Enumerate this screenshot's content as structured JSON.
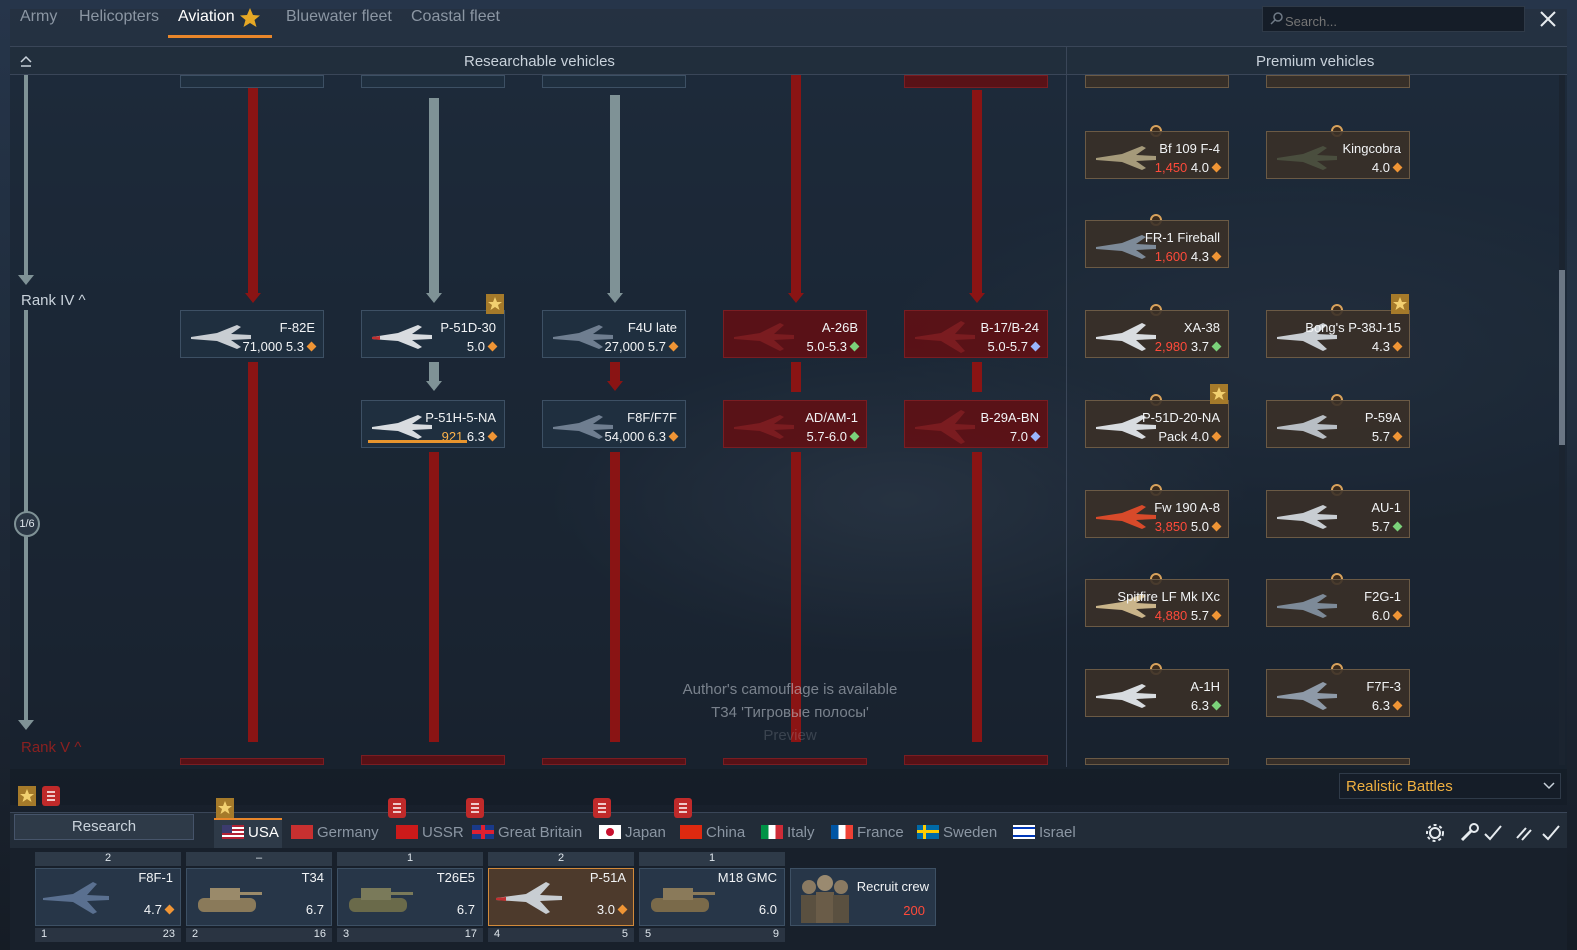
{
  "tabs": [
    {
      "label": "Army",
      "active": false
    },
    {
      "label": "Helicopters",
      "active": false
    },
    {
      "label": "Aviation",
      "active": true
    },
    {
      "label": "Bluewater fleet",
      "active": false
    },
    {
      "label": "Coastal fleet",
      "active": false
    }
  ],
  "search": {
    "placeholder": "Search..."
  },
  "header": {
    "researchable": "Researchable vehicles",
    "premium": "Premium vehicles"
  },
  "rank": {
    "iv": "Rank IV",
    "v": "Rank V"
  },
  "page_indicator": "1/6",
  "research_cards": [
    {
      "name": "F-82E",
      "cost": "71,000",
      "br": "5.3"
    },
    {
      "name": "P-51D-30",
      "cost": "",
      "br": "5.0"
    },
    {
      "name": "F4U late",
      "cost": "27,000",
      "br": "5.7"
    },
    {
      "name": "A-26B",
      "cost": "",
      "br": "5.0-5.3"
    },
    {
      "name": "B-17/B-24",
      "cost": "",
      "br": "5.0-5.7"
    },
    {
      "name": "P-51H-5-NA",
      "cost": "921",
      "br": "6.3",
      "progress": 0.75
    },
    {
      "name": "F8F/F7F",
      "cost": "54,000",
      "br": "6.3"
    },
    {
      "name": "AD/AM-1",
      "cost": "",
      "br": "5.7-6.0"
    },
    {
      "name": "B-29A-BN",
      "cost": "",
      "br": "7.0"
    }
  ],
  "premium_cards": [
    {
      "name": "Bf 109 F-4",
      "cost": "1,450",
      "br": "4.0"
    },
    {
      "name": "Kingcobra",
      "cost": "",
      "br": "4.0"
    },
    {
      "name": "FR-1 Fireball",
      "cost": "1,600",
      "br": "4.3"
    },
    {
      "name": "XA-38",
      "cost": "2,980",
      "br": "3.7"
    },
    {
      "name": "Bong's P-38J-15",
      "cost": "",
      "br": "4.3"
    },
    {
      "name": "P-51D-20-NA",
      "cost": "Pack",
      "br": "4.0"
    },
    {
      "name": "P-59A",
      "cost": "",
      "br": "5.7"
    },
    {
      "name": "Fw 190 A-8",
      "cost": "3,850",
      "br": "5.0"
    },
    {
      "name": "AU-1",
      "cost": "",
      "br": "5.7"
    },
    {
      "name": "Spitfire LF Mk IXc",
      "cost": "4,880",
      "br": "5.7"
    },
    {
      "name": "F2G-1",
      "cost": "",
      "br": "6.0"
    },
    {
      "name": "A-1H",
      "cost": "",
      "br": "6.3"
    },
    {
      "name": "F7F-3",
      "cost": "",
      "br": "6.3"
    }
  ],
  "notice": {
    "line1": "Author's camouflage is available",
    "line2": "T34 'Тигровые полосы'",
    "line3": "Preview"
  },
  "game_mode": "Realistic Battles",
  "research_button": "Research",
  "nations": [
    "USA",
    "Germany",
    "USSR",
    "Great Britain",
    "Japan",
    "China",
    "Italy",
    "France",
    "Sweden",
    "Israel"
  ],
  "crew_slots": [
    {
      "top": "2",
      "name": "F8F-1",
      "br": "4.7",
      "num": "1",
      "count": "23"
    },
    {
      "top": "–",
      "name": "T34",
      "br": "6.7",
      "num": "2",
      "count": "16"
    },
    {
      "top": "1",
      "name": "T26E5",
      "br": "6.7",
      "num": "3",
      "count": "17"
    },
    {
      "top": "2",
      "name": "P-51A",
      "br": "3.0",
      "num": "4",
      "count": "5"
    },
    {
      "top": "1",
      "name": "M18 GMC",
      "br": "6.0",
      "num": "5",
      "count": "9"
    }
  ],
  "recruit": {
    "label": "Recruit crew",
    "cost": "200"
  },
  "colors": {
    "accent": "#e8862a",
    "red_line": "#8a1414",
    "gray_line": "#7f9296",
    "game_mode": "#f0b040"
  }
}
